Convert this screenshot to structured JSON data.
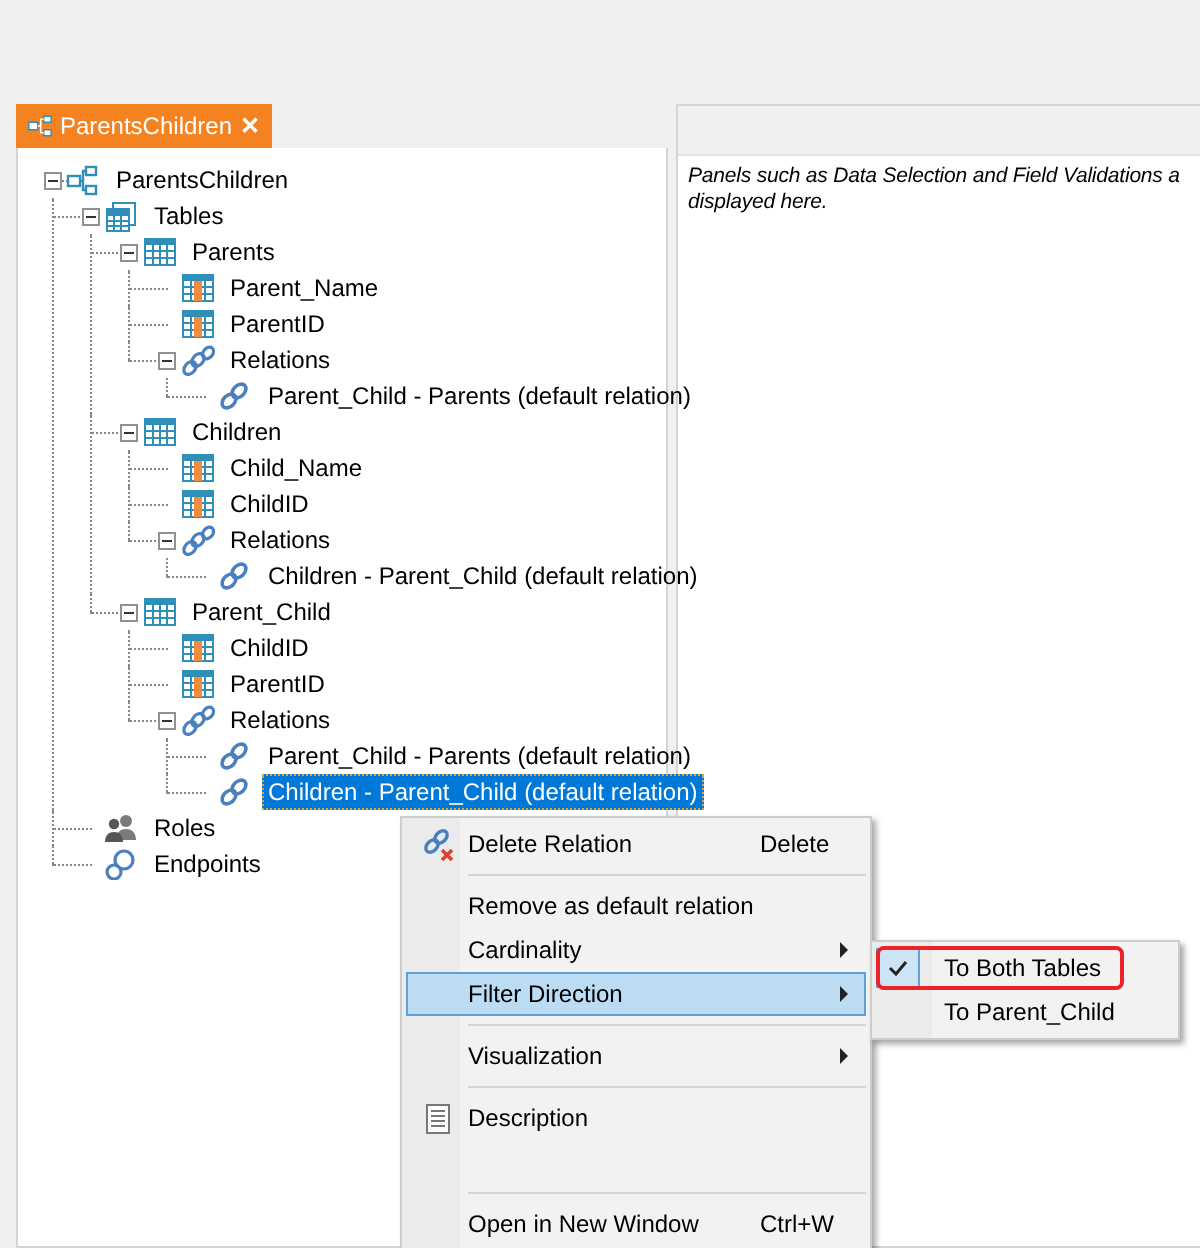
{
  "document_tab": {
    "title": "ParentsChildren",
    "close": "✕",
    "selected": true
  },
  "tree": [
    {
      "label": "ParentsChildren",
      "kind": "model",
      "expanded": true,
      "selected": false,
      "children": [
        {
          "label": "Tables",
          "kind": "tables",
          "expanded": true,
          "selected": false,
          "children": [
            {
              "label": "Parents",
              "kind": "table",
              "expanded": true,
              "selected": false,
              "children": [
                {
                  "label": "Parent_Name",
                  "kind": "column",
                  "selected": false
                },
                {
                  "label": "ParentID",
                  "kind": "column",
                  "selected": false
                },
                {
                  "label": "Relations",
                  "kind": "relations",
                  "expanded": true,
                  "selected": false,
                  "children": [
                    {
                      "label": "Parent_Child - Parents (default relation)",
                      "kind": "relation",
                      "selected": false
                    }
                  ]
                }
              ]
            },
            {
              "label": "Children",
              "kind": "table",
              "expanded": true,
              "selected": false,
              "children": [
                {
                  "label": "Child_Name",
                  "kind": "column",
                  "selected": false
                },
                {
                  "label": "ChildID",
                  "kind": "column",
                  "selected": false
                },
                {
                  "label": "Relations",
                  "kind": "relations",
                  "expanded": true,
                  "selected": false,
                  "children": [
                    {
                      "label": "Children - Parent_Child (default relation)",
                      "kind": "relation",
                      "selected": false
                    }
                  ]
                }
              ]
            },
            {
              "label": "Parent_Child",
              "kind": "table",
              "expanded": true,
              "selected": false,
              "children": [
                {
                  "label": "ChildID",
                  "kind": "column",
                  "selected": false
                },
                {
                  "label": "ParentID",
                  "kind": "column",
                  "selected": false
                },
                {
                  "label": "Relations",
                  "kind": "relations",
                  "expanded": true,
                  "selected": false,
                  "children": [
                    {
                      "label": "Parent_Child - Parents (default relation)",
                      "kind": "relation",
                      "selected": false
                    },
                    {
                      "label": "Children - Parent_Child (default relation)",
                      "kind": "relation",
                      "selected": true
                    }
                  ]
                }
              ]
            }
          ]
        },
        {
          "label": "Roles",
          "kind": "roles",
          "selected": false
        },
        {
          "label": "Endpoints",
          "kind": "endpoints",
          "selected": false
        }
      ]
    }
  ],
  "info_panel": {
    "lines": [
      "Panels such as Data Selection and Field Validations a",
      "displayed here."
    ]
  },
  "context_menu": {
    "items": [
      {
        "kind": "delete",
        "label": "Delete Relation",
        "shortcut": "Delete",
        "submenu": false,
        "highlighted": false
      },
      {
        "kind": "separator"
      },
      {
        "kind": "item",
        "label": "Remove as default relation",
        "submenu": false,
        "highlighted": false
      },
      {
        "kind": "item",
        "label": "Cardinality",
        "submenu": true,
        "highlighted": false
      },
      {
        "kind": "item",
        "label": "Filter Direction",
        "submenu": true,
        "highlighted": true
      },
      {
        "kind": "separator"
      },
      {
        "kind": "item",
        "label": "Visualization",
        "submenu": true,
        "highlighted": false
      },
      {
        "kind": "separator"
      },
      {
        "kind": "document",
        "label": "Description",
        "submenu": false,
        "highlighted": false
      },
      {
        "kind": "blank"
      },
      {
        "kind": "separator"
      },
      {
        "kind": "item",
        "label": "Open in New Window",
        "shortcut": "Ctrl+W",
        "submenu": false,
        "highlighted": false
      }
    ]
  },
  "submenu": {
    "items": [
      {
        "label": "To Both Tables",
        "checked": true,
        "annotated": true
      },
      {
        "label": "To Parent_Child",
        "checked": false,
        "annotated": false
      }
    ]
  }
}
